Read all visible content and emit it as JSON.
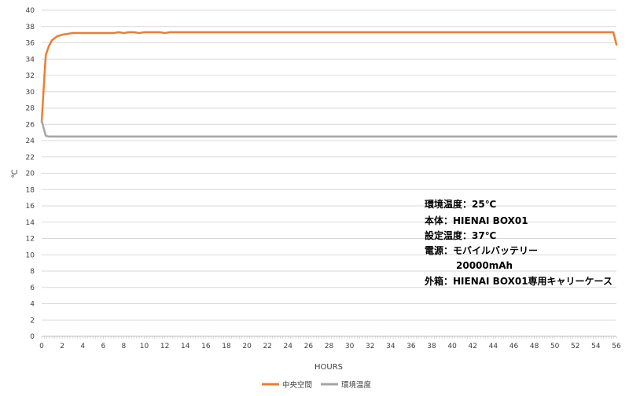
{
  "chart_data": {
    "type": "line",
    "xlabel": "HOURS",
    "ylabel": "℃",
    "xlim": [
      0,
      56
    ],
    "ylim": [
      0,
      40
    ],
    "x_ticks": [
      0,
      2,
      4,
      6,
      8,
      10,
      12,
      14,
      16,
      18,
      20,
      22,
      24,
      26,
      28,
      30,
      32,
      34,
      36,
      38,
      40,
      42,
      44,
      46,
      48,
      50,
      52,
      54,
      56
    ],
    "y_ticks": [
      0,
      2,
      4,
      6,
      8,
      10,
      12,
      14,
      16,
      18,
      20,
      22,
      24,
      26,
      28,
      30,
      32,
      34,
      36,
      38,
      40
    ],
    "grid": "horizontal",
    "legend_position": "bottom-center",
    "series": [
      {
        "name": "中央空間",
        "color": "#ed7d31",
        "points": [
          [
            0,
            26.3
          ],
          [
            0.2,
            30.5
          ],
          [
            0.4,
            34.5
          ],
          [
            0.7,
            35.6
          ],
          [
            1.0,
            36.3
          ],
          [
            1.5,
            36.8
          ],
          [
            2.0,
            37.0
          ],
          [
            2.5,
            37.1
          ],
          [
            3.0,
            37.2
          ],
          [
            5.0,
            37.2
          ],
          [
            7.0,
            37.2
          ],
          [
            7.5,
            37.3
          ],
          [
            8.0,
            37.2
          ],
          [
            8.5,
            37.3
          ],
          [
            9.0,
            37.3
          ],
          [
            9.5,
            37.2
          ],
          [
            10.0,
            37.3
          ],
          [
            11.5,
            37.3
          ],
          [
            12.0,
            37.2
          ],
          [
            12.5,
            37.3
          ],
          [
            20,
            37.3
          ],
          [
            30,
            37.3
          ],
          [
            40,
            37.3
          ],
          [
            50,
            37.3
          ],
          [
            55.7,
            37.3
          ],
          [
            56,
            35.8
          ]
        ]
      },
      {
        "name": "環境温度",
        "color": "#a5a5a5",
        "points": [
          [
            0,
            26.5
          ],
          [
            0.2,
            25.5
          ],
          [
            0.4,
            24.6
          ],
          [
            0.7,
            24.5
          ],
          [
            1.0,
            24.5
          ],
          [
            10,
            24.5
          ],
          [
            20,
            24.5
          ],
          [
            30,
            24.5
          ],
          [
            40,
            24.5
          ],
          [
            50,
            24.5
          ],
          [
            56,
            24.5
          ]
        ]
      }
    ],
    "annotation_lines": [
      "環境温度：25℃",
      "本体：HIENAI BOX01",
      "設定温度：37℃",
      "電源：モバイルバッテリー",
      "20000mAh",
      "外箱：HIENAI BOX01専用キャリーケース"
    ]
  },
  "colors": {
    "gridline": "#d9d9d9",
    "axis_line": "#bfbfbf",
    "background": "#ffffff"
  }
}
